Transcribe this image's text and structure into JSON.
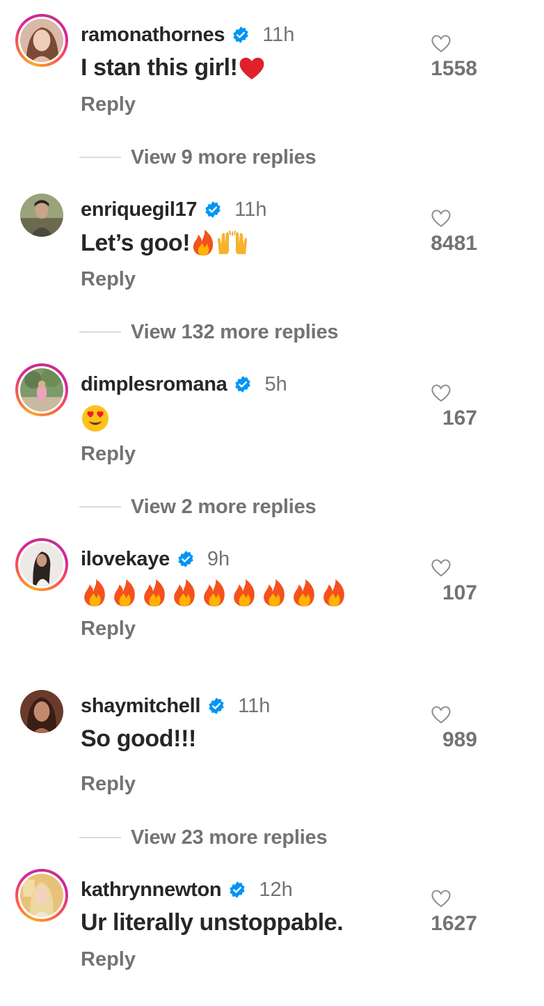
{
  "comments": [
    {
      "username": "ramonathornes",
      "time": "11h",
      "text": "I stan this girl!",
      "emojis": [
        "red-heart"
      ],
      "likes": "1558",
      "reply_label": "Reply",
      "view_replies": "View 9 more replies",
      "story_ring": true
    },
    {
      "username": "enriquegil17",
      "time": "11h",
      "text": "Let’s goo!",
      "emojis": [
        "fire",
        "raising-hands"
      ],
      "likes": "8481",
      "reply_label": "Reply",
      "view_replies": "View 132 more replies",
      "story_ring": false
    },
    {
      "username": "dimplesromana",
      "time": "5h",
      "text": "",
      "emojis": [
        "heart-eyes"
      ],
      "likes": "167",
      "reply_label": "Reply",
      "view_replies": "View 2 more replies",
      "story_ring": true
    },
    {
      "username": "ilovekaye",
      "time": "9h",
      "text": "",
      "emojis": [
        "fire",
        "fire",
        "fire",
        "fire",
        "fire",
        "fire",
        "fire",
        "fire",
        "fire"
      ],
      "likes": "107",
      "reply_label": "Reply",
      "view_replies": "",
      "story_ring": true
    },
    {
      "username": "shaymitchell",
      "time": "11h",
      "text": "So good!!!",
      "emojis": [],
      "likes": "989",
      "reply_label": "Reply",
      "view_replies": "View 23 more replies",
      "story_ring": false
    },
    {
      "username": "kathrynnewton",
      "time": "12h",
      "text": "Ur literally unstoppable.",
      "emojis": [],
      "likes": "1627",
      "reply_label": "Reply",
      "view_replies": "",
      "story_ring": true
    }
  ],
  "icons": {
    "verified": "verified-badge-icon",
    "like": "heart-outline-icon"
  },
  "colors": {
    "verified_blue": "#0095f6",
    "text_primary": "#262626",
    "text_secondary": "#737373",
    "divider": "#dbdbdb"
  }
}
